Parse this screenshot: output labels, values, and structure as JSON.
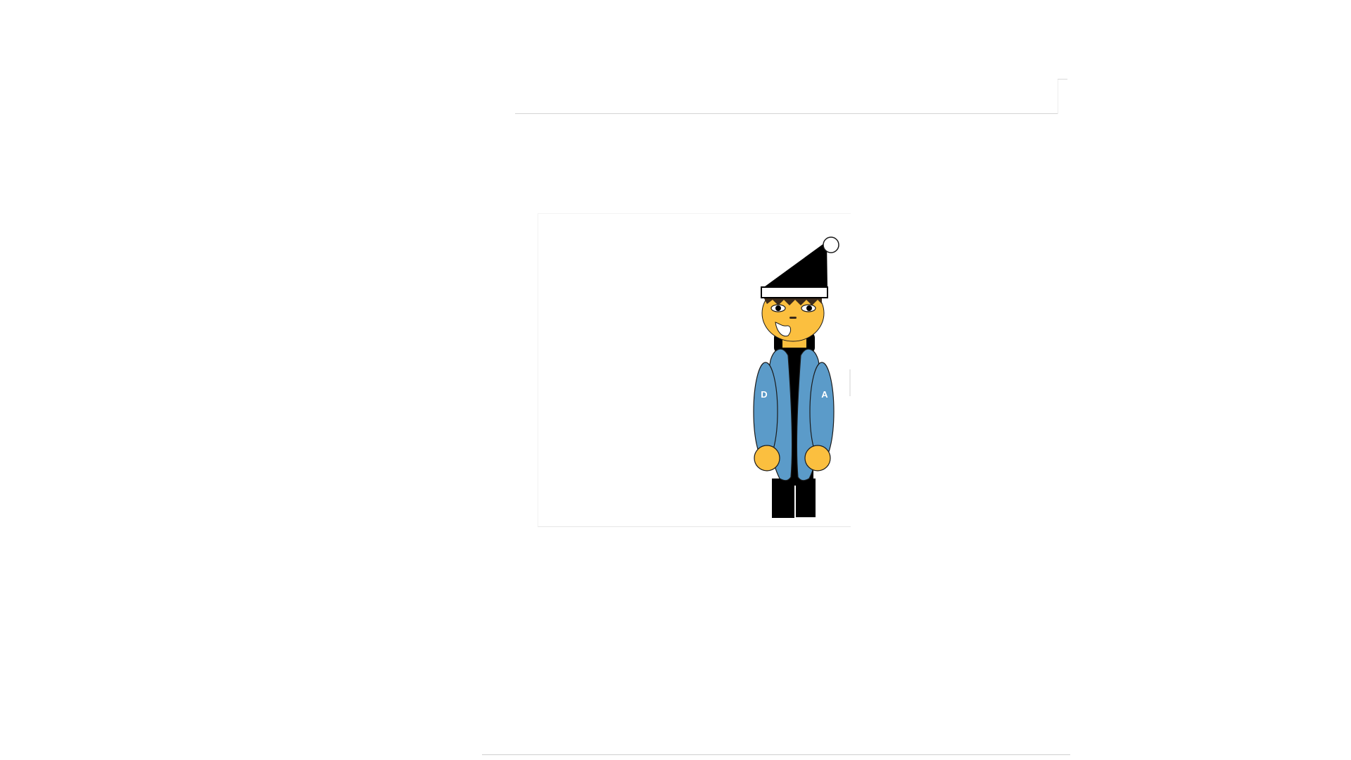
{
  "illustration": {
    "sleeve_left_letter": "D",
    "sleeve_right_letter": "A",
    "colors": {
      "skin": "#fbbf3f",
      "jacket": "#5b9bc9",
      "hat": "#000000",
      "hat_band": "#ffffff",
      "pompom": "#ffffff",
      "pants": "#000000",
      "shirt": "#000000",
      "hair": "#3b2a1a",
      "outline": "#1a1a1a"
    }
  }
}
